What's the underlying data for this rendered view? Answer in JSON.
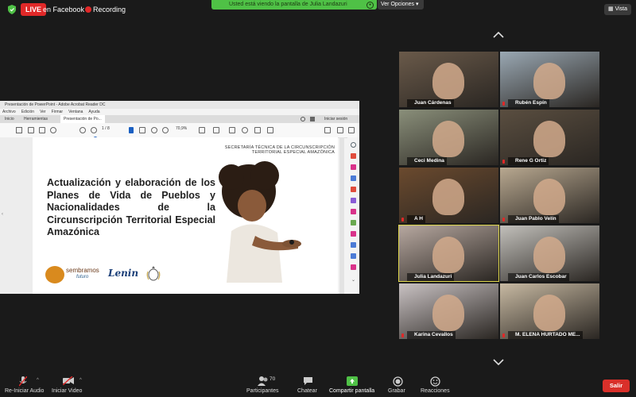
{
  "top": {
    "live_label": "LIVE",
    "live_target": "en Facebook",
    "recording": "Recording",
    "share_banner": "Usted está viendo la pantalla de Julia Landazuri",
    "view_options": "Ver Opciones",
    "vista": "Vista"
  },
  "acrobat": {
    "window_title": "Presentación de PowerPoint - Adobe Acrobat Reader DC",
    "menu": [
      "Archivo",
      "Edición",
      "Ver",
      "Firmar",
      "Ventana",
      "Ayuda"
    ],
    "tabs": [
      "Inicio",
      "Herramientas",
      "Presentación de Po..."
    ],
    "signin": "Iniciar sesión",
    "page_current": "1",
    "page_total": "/ 8",
    "zoom": "70,9%"
  },
  "slide": {
    "header_line1": "SECRETARÍA TÉCNICA DE LA CIRCUNSCRIPCIÓN",
    "header_line2": "TERRITORIAL ESPECIAL AMAZÓNICA",
    "title": "Actualización y elaboración de los Planes de Vida de Pueblos y Nacionalidades de la Circunscripción Territorial Especial Amazónica",
    "logo1": "sembramos",
    "logo1_sub": "futuro",
    "logo2": "Lenin"
  },
  "participants": [
    {
      "name": "Juan Cárdenas",
      "muted": false,
      "color": "#6a5a4a"
    },
    {
      "name": "Rubén Espín",
      "muted": true,
      "color": "#9aa8b3"
    },
    {
      "name": "Ceci Medina",
      "muted": false,
      "color": "#8a8f7a"
    },
    {
      "name": "Rene G Ortiz",
      "muted": true,
      "color": "#5a4e40"
    },
    {
      "name": "A H",
      "muted": true,
      "color": "#6b4a2e"
    },
    {
      "name": "Juan Pablo Velín",
      "muted": true,
      "color": "#b8a890"
    },
    {
      "name": "Julia Landazuri",
      "muted": false,
      "color": "#b7a8a0",
      "active": true
    },
    {
      "name": "Juan Carlos Escobar",
      "muted": false,
      "color": "#c2c0bb"
    },
    {
      "name": "Karina Cevallos",
      "muted": true,
      "color": "#c9c2c3"
    },
    {
      "name": "M. ELENA HURTADO ME...",
      "muted": true,
      "color": "#c7b9a2"
    }
  ],
  "bottom": {
    "audio": "Re-Iniciar Audio",
    "video": "Iniciar Video",
    "participants": "Participantes",
    "participants_count": "70",
    "chat": "Chatear",
    "share": "Compartir pantalla",
    "record": "Grabar",
    "reactions": "Reacciones",
    "leave": "Salir"
  },
  "colors": {
    "live_red": "#e02828",
    "share_green": "#4fc146",
    "leave_red": "#d9302a",
    "active_speaker": "#ddd54a"
  }
}
